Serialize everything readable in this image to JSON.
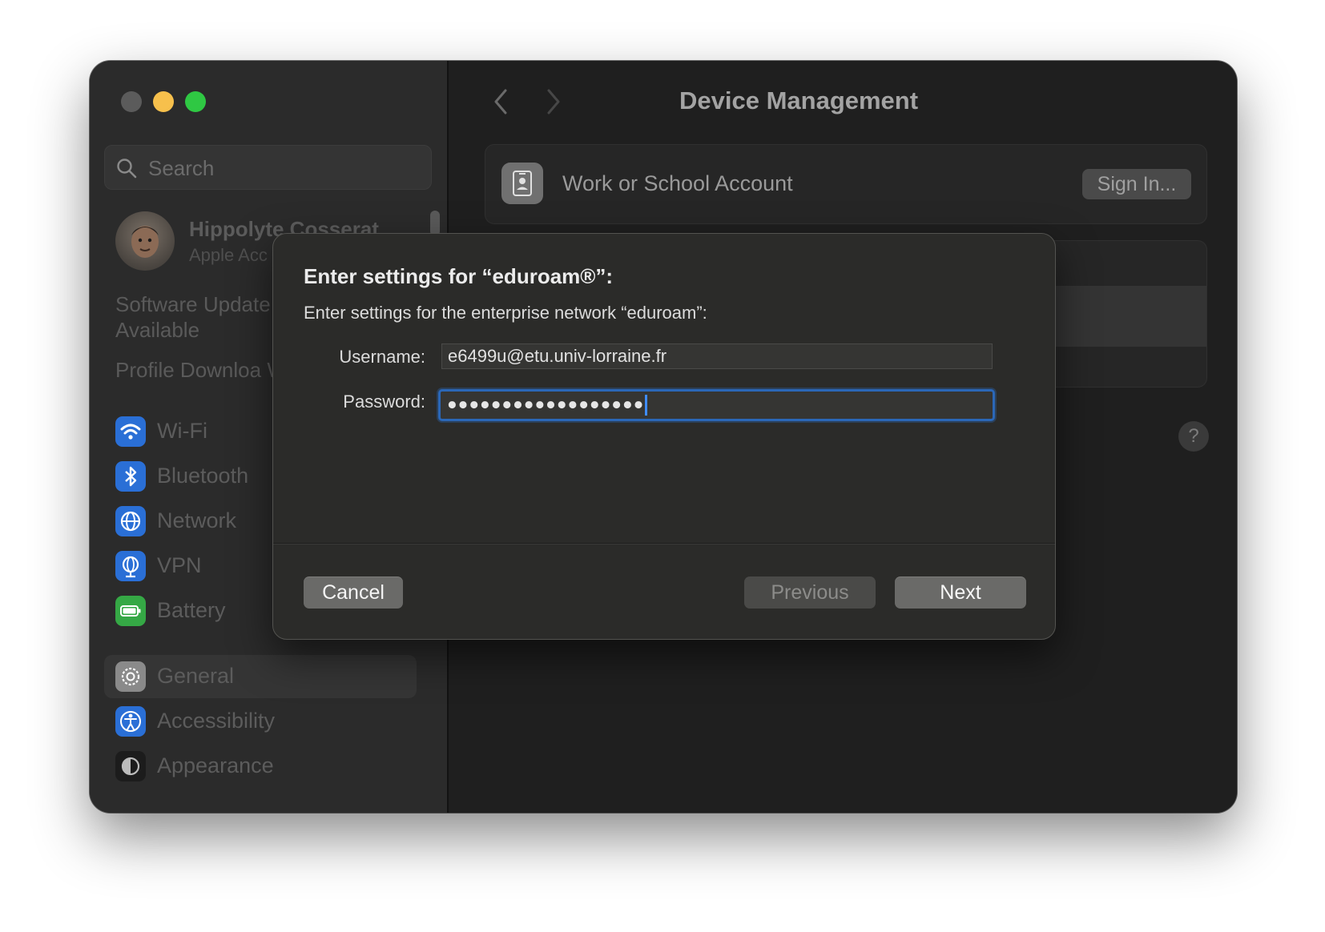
{
  "window": {
    "controls": [
      "close",
      "minimize",
      "maximize"
    ]
  },
  "sidebar": {
    "search": {
      "placeholder": "Search",
      "icon": "magnifier-icon"
    },
    "user": {
      "name": "Hippolyte Cosserat",
      "subtitle": "Apple Acc"
    },
    "notices": [
      {
        "line1": "Software Update",
        "line2": "Available"
      },
      {
        "line1": "Profile Downloa"
      }
    ],
    "items": [
      {
        "label": "Wi-Fi",
        "icon": "wifi-icon",
        "color": "#2a6fd6"
      },
      {
        "label": "Bluetooth",
        "icon": "bluetooth-icon",
        "color": "#2a6fd6"
      },
      {
        "label": "Network",
        "icon": "globe-icon",
        "color": "#2a6fd6"
      },
      {
        "label": "VPN",
        "icon": "vpn-globe-icon",
        "color": "#2a6fd6"
      },
      {
        "label": "Battery",
        "icon": "battery-icon",
        "color": "#35a845"
      },
      {
        "label": "General",
        "icon": "gear-icon",
        "color": "#8a8a8a",
        "selected": true
      },
      {
        "label": "Accessibility",
        "icon": "accessibility-icon",
        "color": "#2a6fd6"
      },
      {
        "label": "Appearance",
        "icon": "appearance-icon",
        "color": "#1c1c1c"
      }
    ]
  },
  "main": {
    "title": "Device Management",
    "account_card": {
      "label": "Work or School Account",
      "button": "Sign In...",
      "icon": "id-badge-icon"
    },
    "help": "?"
  },
  "dialog": {
    "title": "Enter settings for “eduroam®”:",
    "subtitle": "Enter settings for the enterprise network “eduroam”:",
    "username_label": "Username:",
    "username_value": "e6499u@etu.univ-lorraine.fr",
    "password_label": "Password:",
    "password_mask": "●●●●●●●●●●●●●●●●●●",
    "cancel": "Cancel",
    "previous": "Previous",
    "next": "Next",
    "accent": "#2b67b7"
  }
}
